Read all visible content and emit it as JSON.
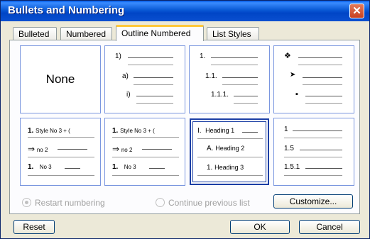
{
  "window": {
    "title": "Bullets and Numbering",
    "close_glyph": "✕"
  },
  "tabs": [
    {
      "label": "Bulleted",
      "active": false
    },
    {
      "label": "Numbered",
      "active": false
    },
    {
      "label": "Outline Numbered",
      "active": true
    },
    {
      "label": "List Styles",
      "active": false
    }
  ],
  "gallery": {
    "none_label": "None",
    "cell2": [
      "1)",
      "a)",
      "i)"
    ],
    "cell3": [
      "1.",
      "1.1.",
      "1.1.1."
    ],
    "cell4_icons": [
      "diamond-bullet-icon",
      "arrow-bullet-icon",
      "square-bullet-icon"
    ],
    "cell4_glyphs": [
      "❖",
      "➤",
      "▪"
    ],
    "cell5": [
      {
        "num": "1.",
        "text": "Style No 3 + ("
      },
      {
        "num": "⇒",
        "text": "no 2"
      },
      {
        "num": "1.",
        "text": "No 3"
      }
    ],
    "cell6": [
      {
        "num": "1.",
        "text": "Style No 3 + ("
      },
      {
        "num": "⇒",
        "text": "no 2"
      },
      {
        "num": "1.",
        "text": "No 3"
      }
    ],
    "cell7": [
      {
        "num": "I.",
        "text": "Heading 1"
      },
      {
        "num": "A.",
        "text": "Heading 2"
      },
      {
        "num": "1.",
        "text": "Heading 3"
      }
    ],
    "cell8": [
      "1",
      "1.5",
      "1.5.1"
    ]
  },
  "options": {
    "restart_label": "Restart numbering",
    "continue_label": "Continue previous list",
    "restart_selected": true
  },
  "buttons": {
    "customize": "Customize...",
    "reset": "Reset",
    "ok": "OK",
    "cancel": "Cancel"
  }
}
